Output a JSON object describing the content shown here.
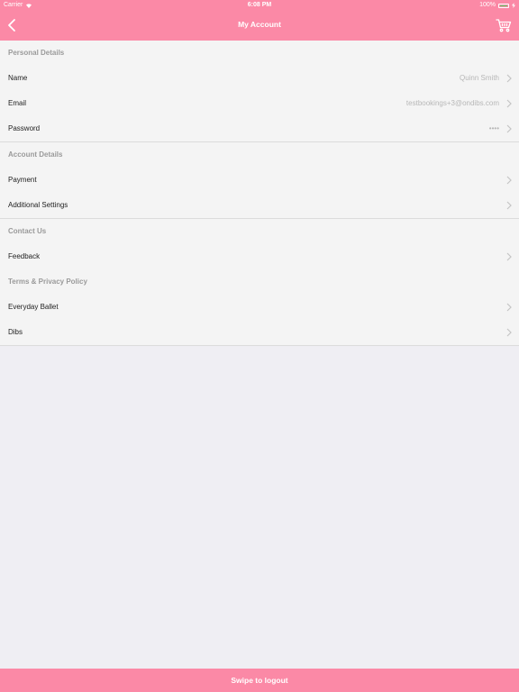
{
  "status_bar": {
    "carrier": "Carrier",
    "time": "6:08 PM",
    "battery": "100%"
  },
  "header": {
    "title": "My Account",
    "back_icon": "chevron-left-icon",
    "cart_icon": "cart-icon"
  },
  "sections": {
    "personal": {
      "title": "Personal Details",
      "name_label": "Name",
      "name_value": "Quinn Smith",
      "email_label": "Email",
      "email_value": "testbookings+3@ondibs.com",
      "password_label": "Password",
      "password_value": "••••"
    },
    "account": {
      "title": "Account Details",
      "payment_label": "Payment",
      "additional_label": "Additional Settings"
    },
    "contact": {
      "title": "Contact Us",
      "feedback_label": "Feedback"
    },
    "terms": {
      "title": "Terms & Privacy Policy",
      "everyday_label": "Everyday Ballet",
      "dibs_label": "Dibs"
    }
  },
  "footer": {
    "logout_label": "Swipe to logout"
  },
  "colors": {
    "brand_pink": "#fb89a6",
    "background": "#efeef3",
    "section_bg": "#f4f4f4"
  }
}
